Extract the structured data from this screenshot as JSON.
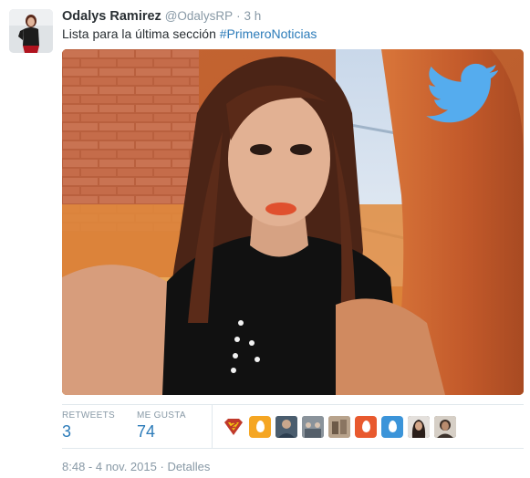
{
  "tweet": {
    "fullname": "Odalys Ramirez",
    "username": "@OdalysRP",
    "separator": "·",
    "time_ago": "3 h",
    "text": "Lista para la última sección ",
    "hashtag": "#PrimeroNoticias"
  },
  "media": {
    "icon": "twitter-bird-icon",
    "brand_color": "#55acee"
  },
  "stats": {
    "retweets_label": "RETWEETS",
    "retweets_value": "3",
    "likes_label": "ME GUSTA",
    "likes_value": "74"
  },
  "likers": [
    {
      "name": "liker-avatar-superman",
      "color": "#c0392b"
    },
    {
      "name": "liker-avatar-egg-orange",
      "color": "#f5a623"
    },
    {
      "name": "liker-avatar-person",
      "color": "#5d6d7e"
    },
    {
      "name": "liker-avatar-group",
      "color": "#7f8c8d"
    },
    {
      "name": "liker-avatar-photo",
      "color": "#a08c7a"
    },
    {
      "name": "liker-avatar-egg-red",
      "color": "#e8592e"
    },
    {
      "name": "liker-avatar-egg-blue",
      "color": "#3b94d9"
    },
    {
      "name": "liker-avatar-woman",
      "color": "#3a2e2a"
    },
    {
      "name": "liker-avatar-man",
      "color": "#6b5a4a"
    }
  ],
  "footer": {
    "timestamp": "8:48 - 4 nov. 2015",
    "separator": "·",
    "details_link": "Detalles"
  }
}
